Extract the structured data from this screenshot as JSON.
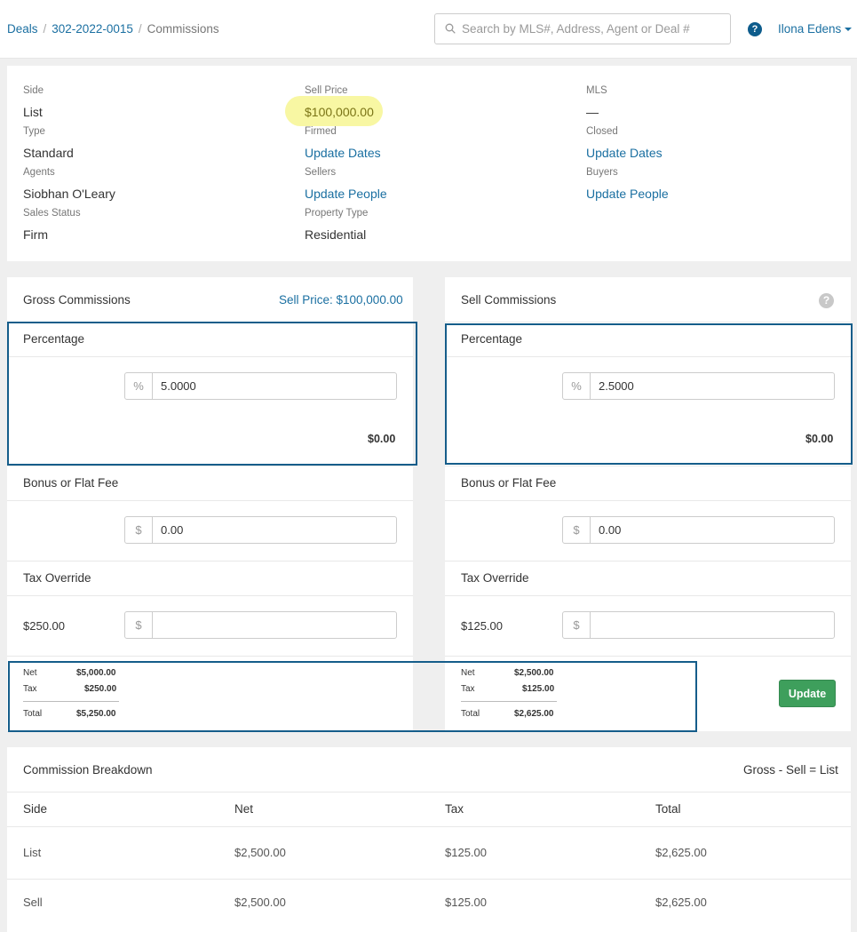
{
  "breadcrumb": {
    "deals": "Deals",
    "deal_id": "302-2022-0015",
    "current": "Commissions"
  },
  "search": {
    "placeholder": "Search by MLS#, Address, Agent or Deal #"
  },
  "user": {
    "name": "Ilona Edens"
  },
  "help_glyph": "?",
  "summary": {
    "side_label": "Side",
    "side_value": "List",
    "type_label": "Type",
    "type_value": "Standard",
    "agents_label": "Agents",
    "agents_value": "Siobhan O'Leary",
    "sales_status_label": "Sales Status",
    "sales_status_value": "Firm",
    "sell_price_label": "Sell Price",
    "sell_price_value": "$100,000.00",
    "firmed_label": "Firmed",
    "firmed_link": "Update Dates",
    "sellers_label": "Sellers",
    "sellers_link": "Update People",
    "property_type_label": "Property Type",
    "property_type_value": "Residential",
    "mls_label": "MLS",
    "mls_value": "—",
    "closed_label": "Closed",
    "closed_link": "Update Dates",
    "buyers_label": "Buyers",
    "buyers_link": "Update People"
  },
  "gross": {
    "title": "Gross Commissions",
    "sell_price_link": "Sell Price: $100,000.00",
    "percentage_label": "Percentage",
    "percent_addon": "%",
    "percent_value": "5.0000",
    "percent_amount": "$0.00",
    "bonus_label": "Bonus or Flat Fee",
    "bonus_addon": "$",
    "bonus_value": "0.00",
    "tax_label": "Tax Override",
    "tax_amount": "$250.00",
    "tax_addon": "$",
    "tax_value": "",
    "net_label": "Net",
    "net_value": "$5,000.00",
    "tax_sum_label": "Tax",
    "tax_sum_value": "$250.00",
    "total_label": "Total",
    "total_value": "$5,250.00"
  },
  "sell": {
    "title": "Sell Commissions",
    "help_glyph": "?",
    "percentage_label": "Percentage",
    "percent_addon": "%",
    "percent_value": "2.5000",
    "percent_amount": "$0.00",
    "bonus_label": "Bonus or Flat Fee",
    "bonus_addon": "$",
    "bonus_value": "0.00",
    "tax_label": "Tax Override",
    "tax_amount": "$125.00",
    "tax_addon": "$",
    "tax_value": "",
    "net_label": "Net",
    "net_value": "$2,500.00",
    "tax_sum_label": "Tax",
    "tax_sum_value": "$125.00",
    "total_label": "Total",
    "total_value": "$2,625.00"
  },
  "update_button": "Update",
  "breakdown": {
    "title": "Commission Breakdown",
    "formula": "Gross - Sell = List",
    "headers": [
      "Side",
      "Net",
      "Tax",
      "Total"
    ],
    "rows": [
      [
        "List",
        "$2,500.00",
        "$125.00",
        "$2,625.00"
      ],
      [
        "Sell",
        "$2,500.00",
        "$125.00",
        "$2,625.00"
      ]
    ]
  },
  "colors": {
    "link": "#1a6fa1",
    "accent_box": "#155d8a",
    "button": "#3e9f5c",
    "highlight": "#f8f7a3"
  }
}
